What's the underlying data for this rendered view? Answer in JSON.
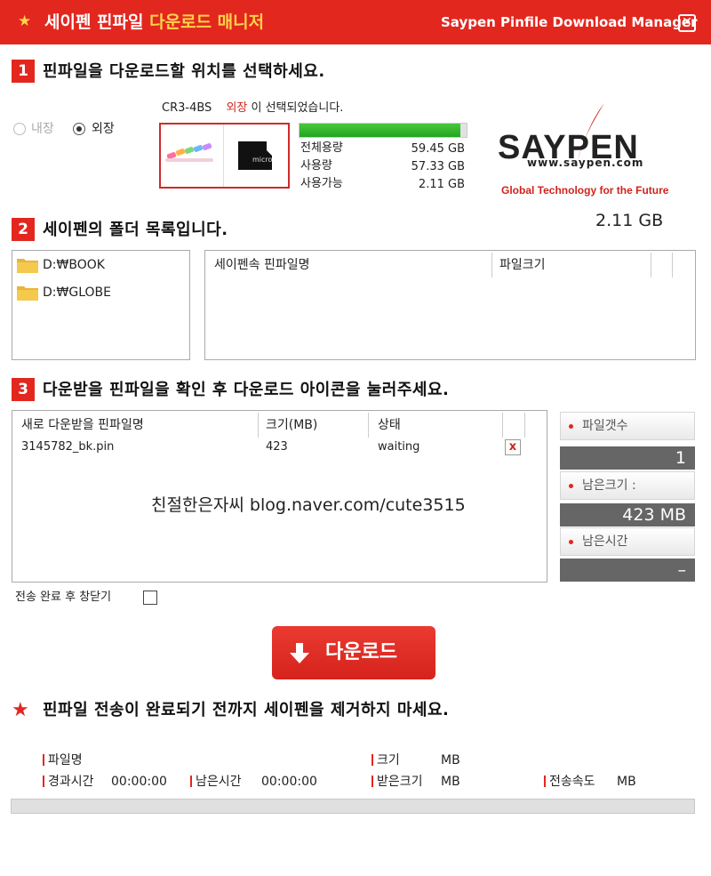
{
  "titlebar": {
    "title_prefix": "세이펜 핀파일 ",
    "title_highlight": "다운로드 매니저",
    "title_en": "Saypen Pinfile Download Manager",
    "close_label": "✕"
  },
  "section1": {
    "number": "1",
    "heading": "핀파일을 다운로드할 위치를 선택하세요.",
    "radio_internal": "내장",
    "radio_external": "외장",
    "selected": "external",
    "device_name": "CR3-4BS",
    "device_type": "외장",
    "device_suffix": "이 선택되었습니다.",
    "usage_fraction": 0.964,
    "stats": [
      {
        "label": "전체용량",
        "value": "59.45 GB"
      },
      {
        "label": "사용량",
        "value": "57.33 GB"
      },
      {
        "label": "사용가능",
        "value": "2.11 GB"
      }
    ],
    "available_big": "2.11 GB"
  },
  "logo": {
    "name": "SAYPEN",
    "url": "www.saypen.com",
    "tagline": "Global Technology for the Future"
  },
  "section2": {
    "number": "2",
    "heading": "세이펜의 폴더 목록입니다.",
    "folders": [
      "D:₩BOOK",
      "D:₩GLOBE"
    ],
    "col_name": "세이펜속 핀파일명",
    "col_size": "파일크기"
  },
  "section3": {
    "number": "3",
    "heading": "다운받을 핀파일을 확인 후 다운로드 아이콘을 눌러주세요.",
    "col_name": "새로 다운받을 핀파일명",
    "col_size": "크기(MB)",
    "col_status": "상태",
    "rows": [
      {
        "name": "3145782_bk.pin",
        "size": "423",
        "status": "waiting",
        "remove": "x"
      }
    ],
    "watermark": "친절한은자씨 blog.naver.com/cute3515",
    "side": {
      "count_label": "파일갯수",
      "count_value": "1",
      "remain_size_label": "남은크기 :",
      "remain_size_value": "423 MB",
      "remain_time_label": "남은시간",
      "remain_time_value": "–"
    },
    "close_after_label": "전송 완료 후 창닫기"
  },
  "download_button": "다운로드",
  "warning": "핀파일 전송이 완료되기 전까지 세이펜을 제거하지 마세요.",
  "info": {
    "filename_label": "파일명",
    "size_label": "크기",
    "size_unit": "MB",
    "elapsed_label": "경과시간",
    "elapsed_value": "00:00:00",
    "remain_label": "남은시간",
    "remain_value": "00:00:00",
    "received_label": "받은크기",
    "received_unit": "MB",
    "speed_label": "전송속도",
    "speed_unit": "MB"
  },
  "progress_fraction": 0,
  "colors": {
    "accent": "#e2271f",
    "highlight": "#ffd24a",
    "usage_green": "#22a51f"
  }
}
